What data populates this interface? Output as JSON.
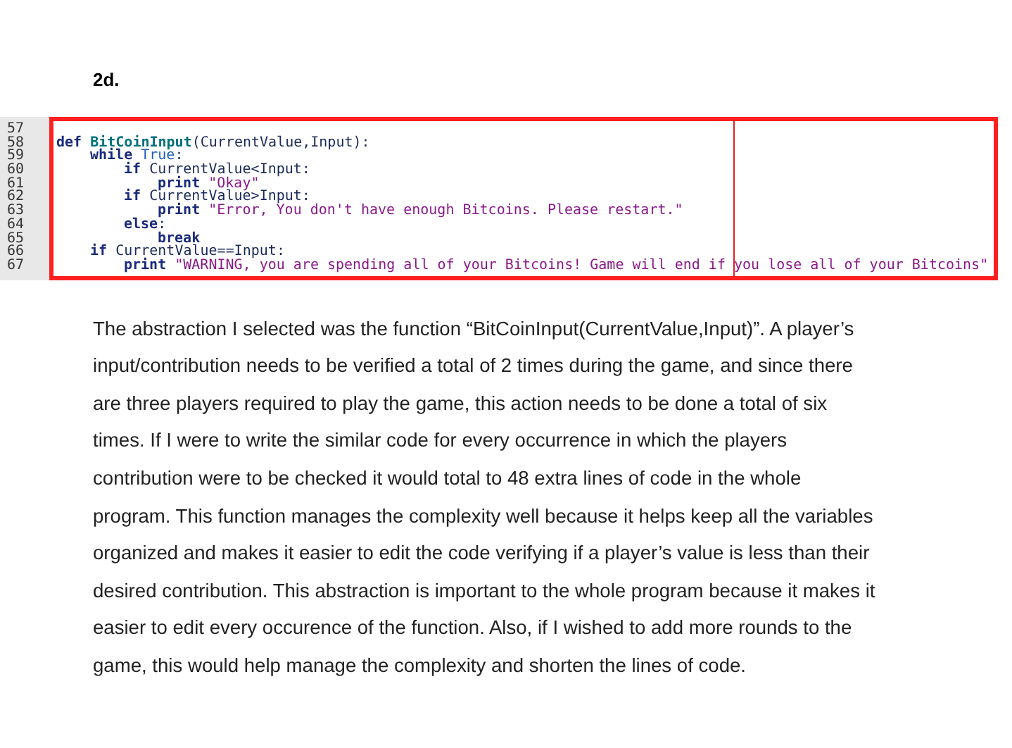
{
  "heading": "2d.",
  "code": {
    "lines": [
      {
        "number": "57"
      },
      {
        "number": "58",
        "tokens": [
          {
            "kind": "keyword",
            "text": "def "
          },
          {
            "kind": "function",
            "text": "BitCoinInput"
          },
          {
            "kind": "plain",
            "text": "(CurrentValue,Input):"
          }
        ],
        "children": [
          {
            "number": "59",
            "tokens": [
              {
                "kind": "keyword",
                "text": "while "
              },
              {
                "kind": "constant",
                "text": "True"
              },
              {
                "kind": "plain",
                "text": ":"
              }
            ],
            "children": [
              {
                "number": "60",
                "tokens": [
                  {
                    "kind": "keyword",
                    "text": "if "
                  },
                  {
                    "kind": "plain",
                    "text": "CurrentValue<Input:"
                  }
                ],
                "children": [
                  {
                    "number": "61",
                    "tokens": [
                      {
                        "kind": "keyword",
                        "text": "print "
                      },
                      {
                        "kind": "string",
                        "text": "\"Okay\""
                      }
                    ]
                  }
                ]
              },
              {
                "number": "62",
                "tokens": [
                  {
                    "kind": "keyword",
                    "text": "if "
                  },
                  {
                    "kind": "plain",
                    "text": "CurrentValue>Input:"
                  }
                ],
                "children": [
                  {
                    "number": "63",
                    "tokens": [
                      {
                        "kind": "keyword",
                        "text": "print "
                      },
                      {
                        "kind": "string",
                        "text": "\"Error, You don't have enough Bitcoins. Please restart.\""
                      }
                    ]
                  }
                ]
              },
              {
                "number": "64",
                "tokens": [
                  {
                    "kind": "keyword",
                    "text": "else"
                  },
                  {
                    "kind": "plain",
                    "text": ":"
                  }
                ],
                "children": [
                  {
                    "number": "65",
                    "tokens": [
                      {
                        "kind": "keyword",
                        "text": "break"
                      }
                    ]
                  }
                ]
              }
            ]
          },
          {
            "number": "66",
            "tokens": [
              {
                "kind": "keyword",
                "text": "if "
              },
              {
                "kind": "plain",
                "text": "CurrentValue==Input:"
              }
            ],
            "children": [
              {
                "number": "67",
                "tokens": [
                  {
                    "kind": "keyword",
                    "text": "print "
                  },
                  {
                    "kind": "string",
                    "text": "\"WARNING, you are spending all of your Bitcoins! Game will end if you lose all of your Bitcoins\""
                  }
                ]
              }
            ]
          }
        ]
      }
    ]
  },
  "paragraph": "The abstraction I selected was the function “BitCoinInput(CurrentValue,Input)”. A player’s input/contribution needs to be verified a total of 2 times during the game, and since there are three players required to play the game, this action needs to be done a total of six times. If I were to write the similar code for every occurrence in which the players contribution were to be checked it would total to 48 extra lines of code in the whole program. This function manages the complexity well because it helps keep all the variables organized and makes it easier to edit the code verifying if a player’s value is less than their desired contribution. This abstraction is important to the whole program because it makes it easier to edit every occurence of the function. Also, if I wished to add more rounds to the game, this would help manage the complexity and shorten the lines of code."
}
